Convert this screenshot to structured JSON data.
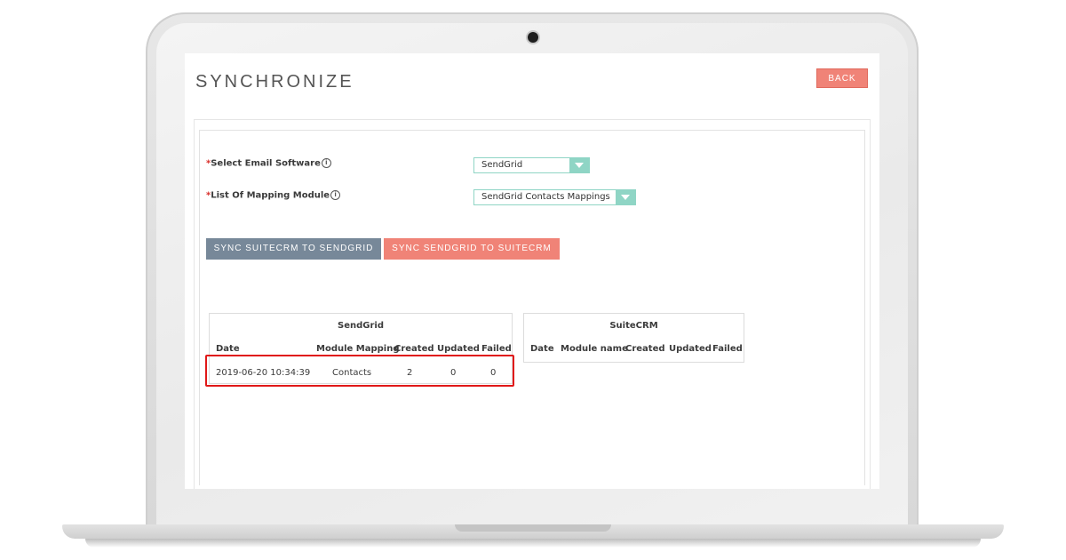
{
  "page": {
    "title": "SYNCHRONIZE",
    "back_label": "BACK"
  },
  "form": {
    "email_software": {
      "required_mark": "*",
      "label": "Select Email Software",
      "info_icon": "i",
      "value": "SendGrid"
    },
    "mapping_module": {
      "required_mark": "*",
      "label": "List Of Mapping Module",
      "info_icon": "i",
      "value": "SendGrid Contacts Mappings"
    }
  },
  "actions": {
    "sync_suitecrm_to_sendgrid": "SYNC SUITECRM TO SENDGRID",
    "sync_sendgrid_to_suitecrm": "SYNC SENDGRID TO SUITECRM"
  },
  "sendgrid_table": {
    "title": "SendGrid",
    "headers": [
      "Date",
      "Module Mapping",
      "Created",
      "Updated",
      "Failed"
    ],
    "rows": [
      [
        "2019-06-20 10:34:39",
        "Contacts",
        "2",
        "0",
        "0"
      ]
    ]
  },
  "suitecrm_table": {
    "title": "SuiteCRM",
    "headers": [
      "Date",
      "Module name",
      "Created",
      "Updated",
      "Failed"
    ],
    "rows": []
  },
  "colors": {
    "primary_button": "#f08377",
    "secondary_button": "#778899",
    "select_accent": "#8fd5c5",
    "highlight": "#e01818"
  }
}
